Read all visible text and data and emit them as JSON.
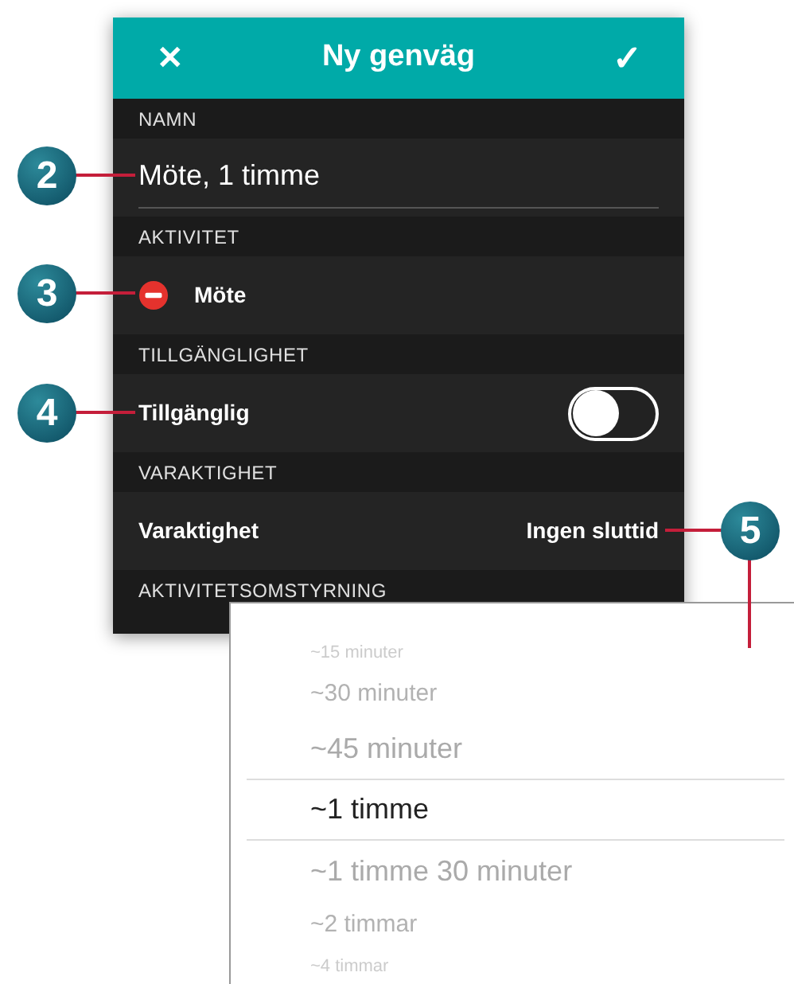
{
  "header": {
    "close": "✕",
    "title": "Ny genväg",
    "confirm": "✓"
  },
  "sections": [
    {
      "heading": "NAMN",
      "kind": "field",
      "value": "Möte, 1 timme"
    },
    {
      "heading": "AKTIVITET",
      "kind": "activity",
      "label": "Möte"
    },
    {
      "heading": "TILLGÄNGLIGHET",
      "kind": "toggle",
      "label": "Tillgänglig",
      "on": false
    },
    {
      "heading": "VARAKTIGHET",
      "kind": "value",
      "label": "Varaktighet",
      "value": "Ingen sluttid"
    },
    {
      "heading": "AKTIVITETSOMSTYRNING",
      "kind": "empty"
    }
  ],
  "callouts": [
    "2",
    "3",
    "4",
    "5"
  ],
  "picker": {
    "items": [
      {
        "label": "~15 minuter",
        "selected": false
      },
      {
        "label": "~30 minuter",
        "selected": false
      },
      {
        "label": "~45 minuter",
        "selected": false
      },
      {
        "label": "~1 timme",
        "selected": true
      },
      {
        "label": "~1 timme 30 minuter",
        "selected": false
      },
      {
        "label": "~2 timmar",
        "selected": false
      },
      {
        "label": "~4 timmar",
        "selected": false
      }
    ]
  }
}
